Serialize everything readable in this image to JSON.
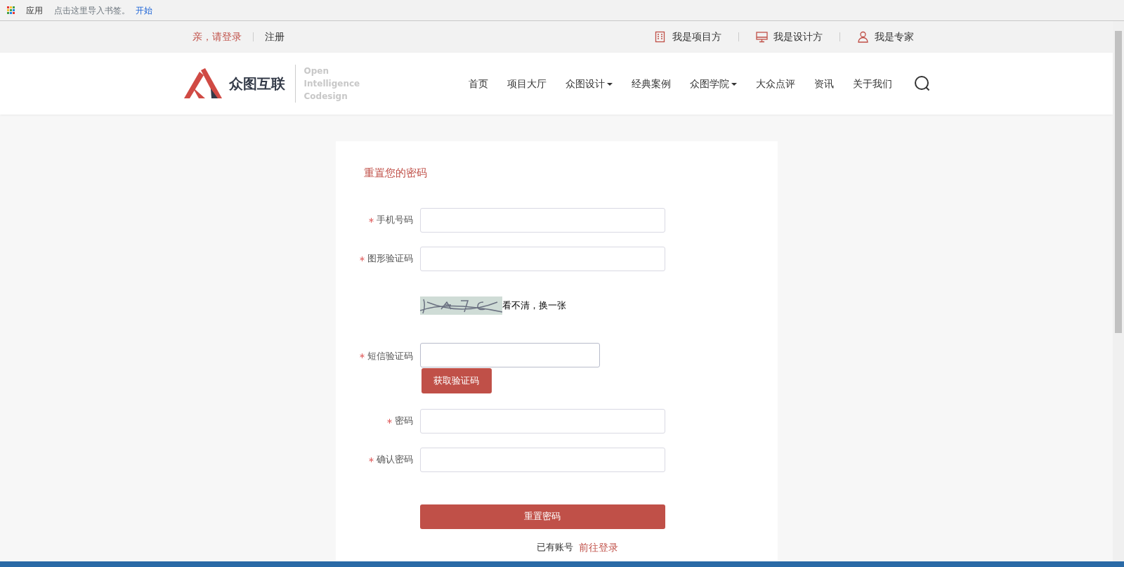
{
  "browser_bar": {
    "apps_label": "应用",
    "bookmark_hint": "点击这里导入书签。",
    "bookmark_link": "开始"
  },
  "top_bar": {
    "login": "亲，请登录",
    "register": "注册",
    "roles": [
      {
        "label": "我是项目方"
      },
      {
        "label": "我是设计方"
      },
      {
        "label": "我是专家"
      }
    ]
  },
  "header": {
    "logo_name": "众图互联",
    "tagline": [
      "Open",
      "Intelligence",
      "Codesign"
    ],
    "nav": [
      {
        "label": "首页",
        "has_dropdown": false
      },
      {
        "label": "项目大厅",
        "has_dropdown": false
      },
      {
        "label": "众图设计",
        "has_dropdown": true
      },
      {
        "label": "经典案例",
        "has_dropdown": false
      },
      {
        "label": "众图学院",
        "has_dropdown": true
      },
      {
        "label": "大众点评",
        "has_dropdown": false
      },
      {
        "label": "资讯",
        "has_dropdown": false
      },
      {
        "label": "关于我们",
        "has_dropdown": false
      }
    ]
  },
  "form": {
    "title": "重置您的密码",
    "fields": [
      {
        "kind": "input",
        "label": "手机号码",
        "required": true
      },
      {
        "kind": "input",
        "label": "图形验证码",
        "required": true
      },
      {
        "kind": "captcha",
        "refresh_link": "看不清，换一张"
      },
      {
        "kind": "sms",
        "label": "短信验证码",
        "required": true,
        "button": "获取验证码"
      },
      {
        "kind": "input",
        "label": "密码",
        "required": true
      },
      {
        "kind": "input",
        "label": "确认密码",
        "required": true
      }
    ],
    "submit": "重置密码",
    "footer_text": "已有账号",
    "footer_link": "前往登录"
  }
}
